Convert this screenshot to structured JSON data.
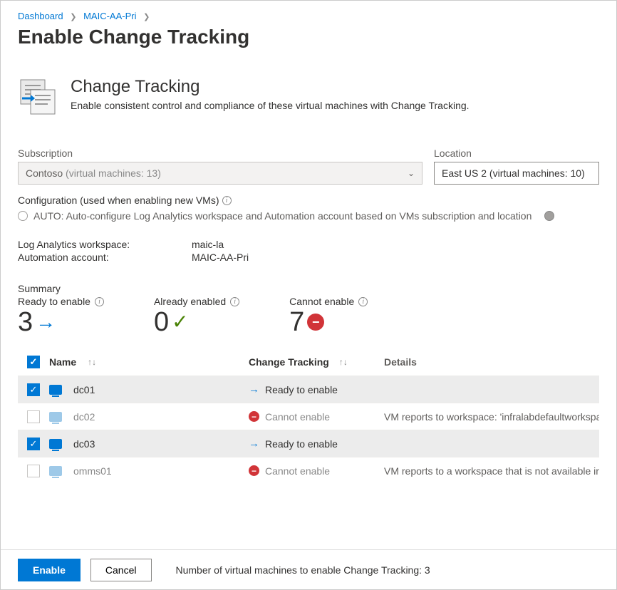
{
  "breadcrumb": {
    "dashboard": "Dashboard",
    "parent": "MAIC-AA-Pri"
  },
  "page_title": "Enable Change Tracking",
  "feature": {
    "title": "Change Tracking",
    "desc": "Enable consistent control and compliance of these virtual machines with Change Tracking."
  },
  "subscription": {
    "label": "Subscription",
    "name": "Contoso",
    "detail": "(virtual machines: 13)"
  },
  "location": {
    "label": "Location",
    "value": "East US 2 (virtual machines: 10)"
  },
  "config": {
    "label": "Configuration (used when enabling new VMs)",
    "auto_option": "AUTO: Auto-configure Log Analytics workspace and Automation account based on VMs subscription and location"
  },
  "workspace": {
    "label": "Log Analytics workspace:",
    "value": "maic-la"
  },
  "automation": {
    "label": "Automation account:",
    "value": "MAIC-AA-Pri"
  },
  "summary": {
    "label": "Summary",
    "ready_label": "Ready to enable",
    "ready_count": "3",
    "already_label": "Already enabled",
    "already_count": "0",
    "cannot_label": "Cannot enable",
    "cannot_count": "7"
  },
  "table": {
    "headers": {
      "name": "Name",
      "tracking": "Change Tracking",
      "details": "Details"
    },
    "rows": [
      {
        "checked": true,
        "name": "dc01",
        "status": "Ready to enable",
        "details": ""
      },
      {
        "checked": false,
        "name": "dc02",
        "status": "Cannot enable",
        "details": "VM reports to workspace: 'infralabdefaultworkspac"
      },
      {
        "checked": true,
        "name": "dc03",
        "status": "Ready to enable",
        "details": ""
      },
      {
        "checked": false,
        "name": "omms01",
        "status": "Cannot enable",
        "details": "VM reports to a workspace that is not available in t"
      }
    ]
  },
  "footer": {
    "enable": "Enable",
    "cancel": "Cancel",
    "text": "Number of virtual machines to enable Change Tracking: 3"
  }
}
